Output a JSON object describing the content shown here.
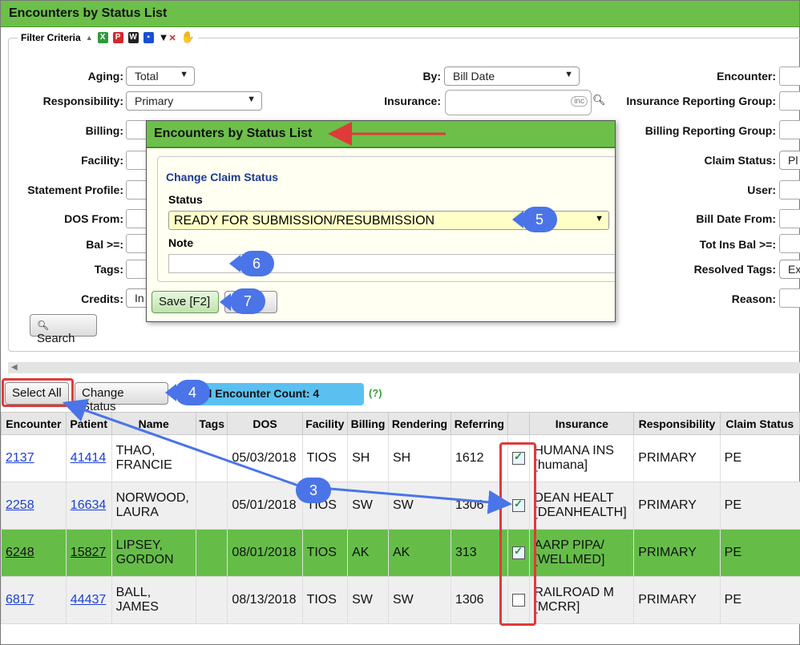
{
  "page": {
    "title": "Encounters by Status List"
  },
  "filter": {
    "legend": "Filter Criteria",
    "toolbar_icons": [
      "collapse-arrow-icon",
      "excel-export-icon",
      "pdf-export-icon",
      "word-export-icon",
      "save-icon",
      "clear-filter-icon",
      "hand-pointer-icon"
    ],
    "labels": {
      "aging": "Aging:",
      "responsibility": "Responsibility:",
      "billing": "Billing:",
      "facility": "Facility:",
      "statement_profile": "Statement Profile:",
      "dos_from": "DOS From:",
      "bal_gte": "Bal >=:",
      "tags": "Tags:",
      "credits": "Credits:",
      "by": "By:",
      "insurance": "Insurance:",
      "encounter": "Encounter:",
      "ins_reporting_group": "Insurance Reporting Group:",
      "billing_reporting_group": "Billing Reporting Group:",
      "claim_status": "Claim Status:",
      "user": "User:",
      "bill_date_from": "Bill Date From:",
      "tot_ins_bal": "Tot Ins Bal >=:",
      "resolved_tags": "Resolved Tags:",
      "reason": "Reason:"
    },
    "values": {
      "aging": "Total",
      "responsibility": "Primary",
      "by": "Bill Date",
      "insurance_badge": "inc",
      "credits": "In",
      "claim_status": "Pl",
      "resolved_tags": "Ex"
    },
    "search_label": "Search"
  },
  "toolbar": {
    "select_all": "Select All",
    "change_status": "Change Status",
    "count_label": "Total Encounter Count: 4",
    "help": "(?)"
  },
  "table": {
    "headers": [
      "Encounter",
      "Patient",
      "Name",
      "Tags",
      "DOS",
      "Facility",
      "Billing",
      "Rendering",
      "Referring",
      "",
      "Insurance",
      "Responsibility",
      "Claim Status"
    ],
    "rows": [
      {
        "encounter": "2137",
        "patient": "41414",
        "name1": "THAO,",
        "name2": "FRANCIE",
        "tags": "",
        "dos": "05/03/2018",
        "facility": "TIOS",
        "billing": "SH",
        "rendering": "SH",
        "referring": "1612",
        "checked": true,
        "ins1": "HUMANA INS",
        "ins2": "[humana]",
        "resp": "PRIMARY",
        "status": "PE"
      },
      {
        "encounter": "2258",
        "patient": "16634",
        "name1": "NORWOOD,",
        "name2": "LAURA",
        "tags": "",
        "dos": "05/01/2018",
        "facility": "TIOS",
        "billing": "SW",
        "rendering": "SW",
        "referring": "1306",
        "checked": true,
        "ins1": "DEAN HEALT",
        "ins2": "[DEANHEALTH]",
        "resp": "PRIMARY",
        "status": "PE"
      },
      {
        "encounter": "6248",
        "patient": "15827",
        "name1": "LIPSEY,",
        "name2": "GORDON",
        "tags": "",
        "dos": "08/01/2018",
        "facility": "TIOS",
        "billing": "AK",
        "rendering": "AK",
        "referring": "313",
        "checked": true,
        "ins1": "AARP PIPA/",
        "ins2": "[WELLMED]",
        "resp": "PRIMARY",
        "status": "PE"
      },
      {
        "encounter": "6817",
        "patient": "44437",
        "name1": "BALL,",
        "name2": "JAMES",
        "tags": "",
        "dos": "08/13/2018",
        "facility": "TIOS",
        "billing": "SW",
        "rendering": "SW",
        "referring": "1306",
        "checked": false,
        "ins1": "RAILROAD M",
        "ins2": "[MCRR]",
        "resp": "PRIMARY",
        "status": "PE"
      }
    ]
  },
  "modal": {
    "title": "Encounters by Status List",
    "fieldset": "Change Claim Status",
    "status_label": "Status",
    "status_value": "READY FOR SUBMISSION/RESUBMISSION",
    "note_label": "Note",
    "note_value": "",
    "save": "Save [F2]",
    "cancel": ""
  },
  "callouts": {
    "c3": "3",
    "c4": "4",
    "c5": "5",
    "c6": "6",
    "c7": "7"
  },
  "colors": {
    "header_green": "#6cc04a",
    "selected_row": "#65bd48",
    "count_blue": "#5bc0f0",
    "callout": "#4a74e8",
    "highlight_red": "#e03a3a"
  }
}
